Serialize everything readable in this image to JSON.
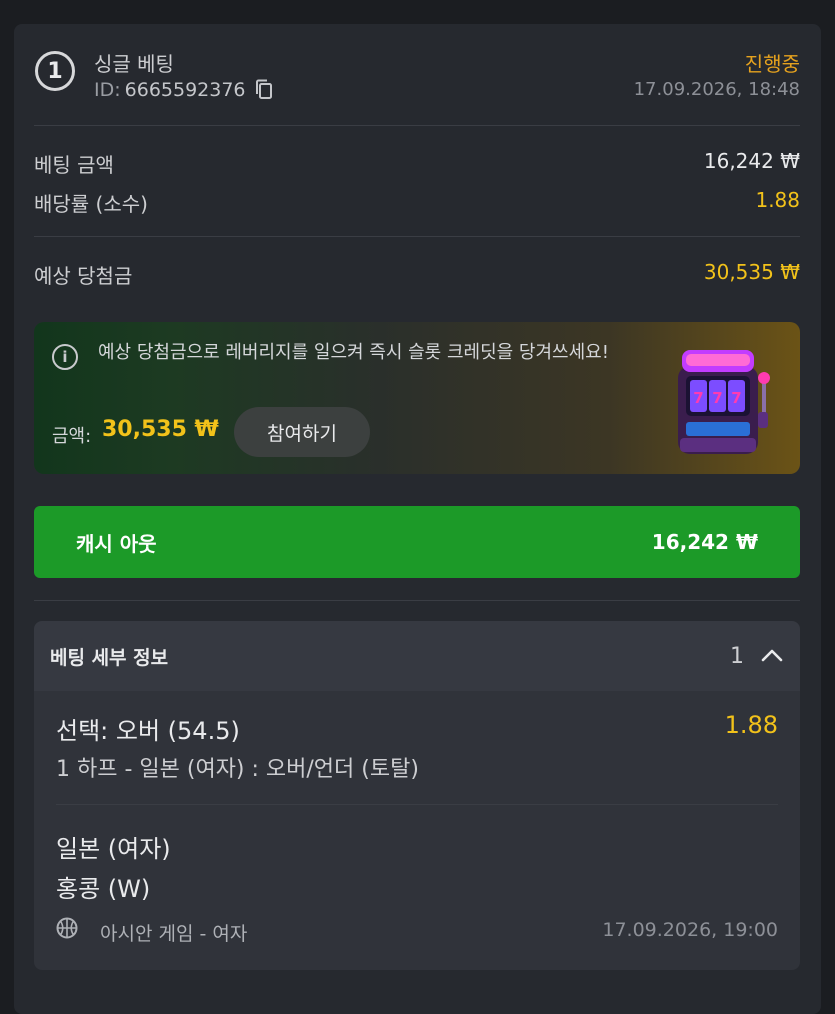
{
  "bet": {
    "number": "1",
    "title": "싱글 베팅",
    "id_label": "ID:",
    "id_value": "6665592376",
    "status": "진행중",
    "datetime": "17.09.2026, 18:48"
  },
  "summary": {
    "stake_label": "베팅 금액",
    "stake_value": "16,242 ₩",
    "odds_label": "배당률 (소수)",
    "odds_value": "1.88",
    "payout_label": "예상 당첨금",
    "payout_value": "30,535 ₩"
  },
  "promo": {
    "text": "예상 당첨금으로 레버리지를 일으켜 즉시 슬롯 크레딧을 당겨쓰세요!",
    "amount_label": "금액:",
    "amount_value": "30,535 ₩",
    "button_label": "참여하기"
  },
  "cashout": {
    "label": "캐시 아웃",
    "value": "16,242 ₩"
  },
  "details": {
    "title": "베팅 세부 정보",
    "count": "1",
    "selection": "선택: 오버 (54.5)",
    "selection_odds": "1.88",
    "market": "1 하프 - 일본 (여자) : 오버/언더 (토탈)",
    "team_home": "일본 (여자)",
    "team_away": "홍콩 (W)",
    "league": "아시안 게임 - 여자",
    "match_time": "17.09.2026, 19:00"
  },
  "colors": {
    "accent_yellow": "#f2c21a",
    "status_orange": "#e6a21e",
    "cashout_green": "#1c9a28"
  },
  "icons": [
    "copy-icon",
    "info-icon",
    "slot-machine-icon",
    "chevron-up-icon",
    "basketball-icon"
  ]
}
